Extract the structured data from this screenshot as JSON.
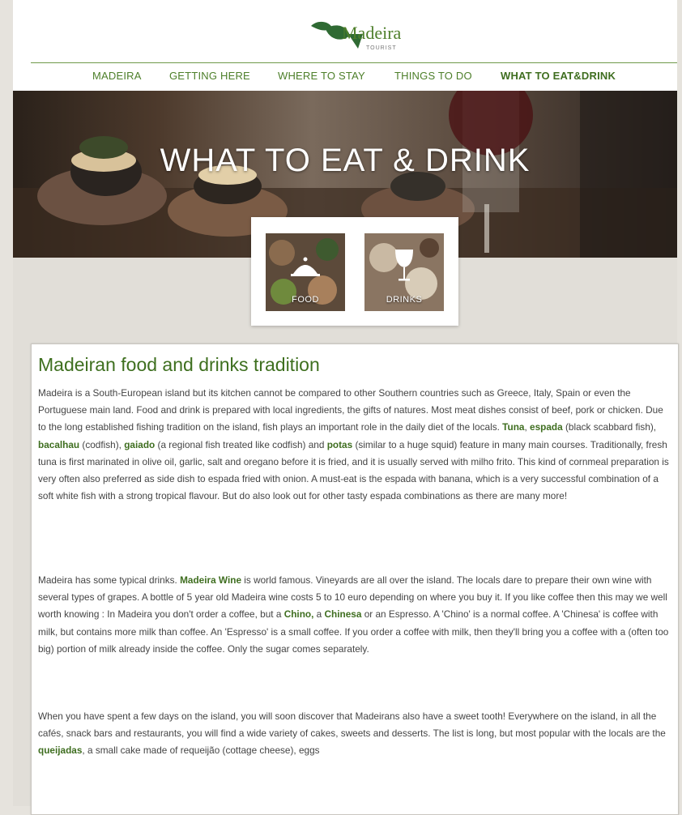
{
  "brand": {
    "name": "Madeira",
    "sub": "TOURIST",
    "logo_icon": "leaf-logo-icon",
    "accent": "#4e7f2b"
  },
  "nav": {
    "items": [
      {
        "label": "MADEIRA"
      },
      {
        "label": "GETTING HERE"
      },
      {
        "label": "WHERE TO STAY"
      },
      {
        "label": "THINGS TO DO"
      },
      {
        "label": "WHAT TO EAT&DRINK",
        "active": true
      }
    ]
  },
  "hero": {
    "title": "WHAT TO EAT & DRINK"
  },
  "categories": [
    {
      "label": "FOOD",
      "icon": "cloche-icon"
    },
    {
      "label": "DRINKS",
      "icon": "wine-glass-icon"
    }
  ],
  "article": {
    "title": "Madeiran food and drinks tradition",
    "p1": [
      "Madeira is a South-European island but its kitchen cannot be compared to other Southern countries such as Greece, Italy, Spain or even the Portuguese main land. Food and drink is prepared with local ingredients, the gifts of natures. Most meat dishes consist of beef, pork or chicken. Due to the long established fishing tradition on the island, fish plays an important role in the daily diet of the locals. ",
      "Tuna",
      ", ",
      "espada",
      " (black scabbard fish), ",
      "bacalhau",
      " (codfish), ",
      "gaiado",
      " (a regional fish treated like codfish) and ",
      "potas",
      " (similar to a huge squid) feature in many main courses. Traditionally, fresh tuna is first marinated in olive oil, garlic, salt and oregano before it is fried, and it is usually served with milho frito. This kind of cornmeal preparation is very often also preferred as side dish to espada fried with onion. A must-eat is the espada with banana, which is a very successful combination of a soft white fish with a strong tropical flavour. But do also look out for other tasty espada combinations as there are many more!"
    ],
    "p2": [
      "Madeira has some typical drinks. ",
      "Madeira Wine",
      " is world famous. Vineyards are all over the island. The locals dare to prepare their own wine with several types of grapes. A bottle of 5 year old Madeira wine costs 5 to 10 euro depending on where you buy it. If you like coffee then this may we well worth knowing : In Madeira you don't order a coffee, but a ",
      "Chino,",
      " a ",
      "Chinesa",
      " or an Espresso. A 'Chino' is a normal coffee. A 'Chinesa' is coffee with milk, but contains more milk than coffee. An 'Espresso' is a small coffee. If you order a coffee with milk, then they'll bring you a coffee with a (often too big) portion of milk already inside the coffee. Only the sugar comes separately."
    ],
    "p3": [
      "When you have spent a few days on the island, you will soon discover that Madeirans also have a sweet tooth! Everywhere on the island, in all the cafés, snack bars and restaurants, you will find a wide variety of cakes, sweets and desserts. The list is long, but most popular with the locals are the ",
      "queijadas",
      ", a small cake made of requeijão (cottage cheese), eggs"
    ]
  }
}
